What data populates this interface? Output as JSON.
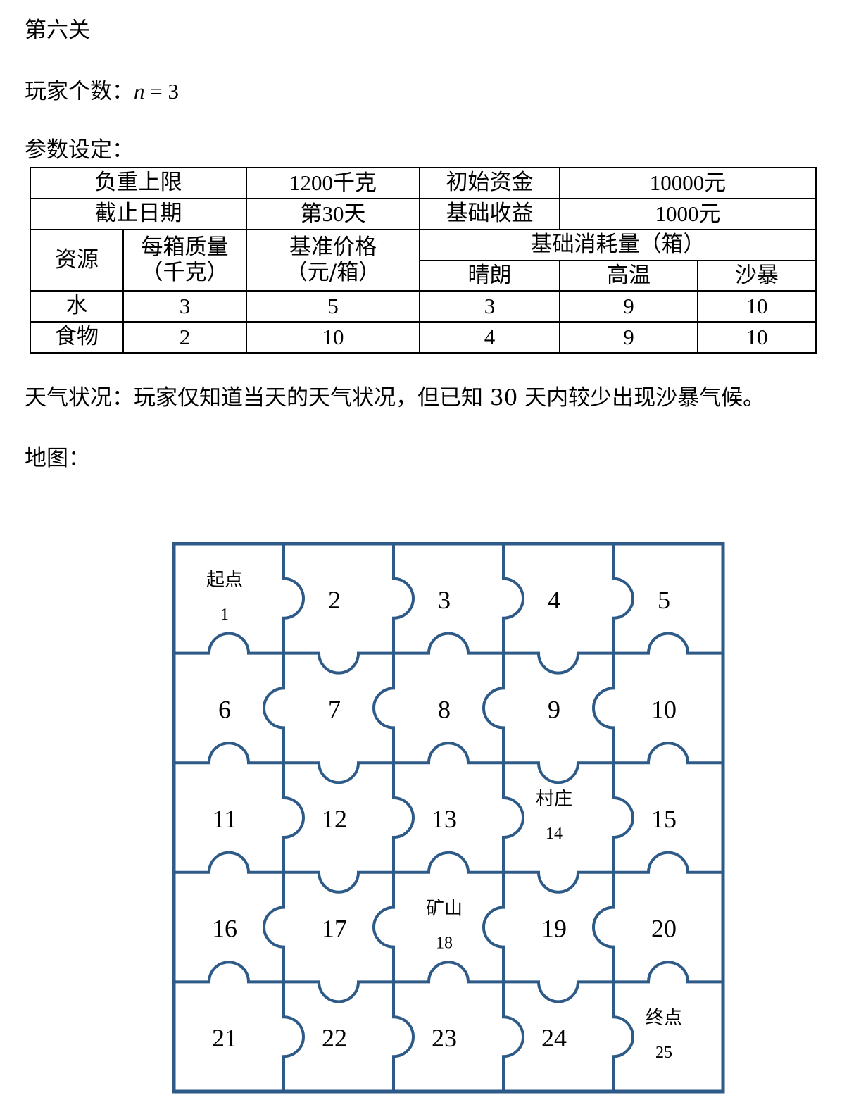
{
  "heading": "第六关",
  "players": {
    "label": "玩家个数：",
    "var": "n",
    "eq": " = ",
    "value": "3"
  },
  "params_label": "参数设定：",
  "table": {
    "load_limit_label": "负重上限",
    "load_limit_value": "1200千克",
    "initial_funds_label": "初始资金",
    "initial_funds_value": "10000元",
    "deadline_label": "截止日期",
    "deadline_value": "第30天",
    "base_income_label": "基础收益",
    "base_income_value": "1000元",
    "resource_header": "资源",
    "mass_header_1": "每箱质量",
    "mass_header_2": "（千克）",
    "price_header_1": "基准价格",
    "price_header_2": "（元/箱）",
    "consumption_header": "基础消耗量（箱）",
    "weather_sunny": "晴朗",
    "weather_hot": "高温",
    "weather_sandstorm": "沙暴",
    "rows": [
      {
        "name": "水",
        "mass": "3",
        "price": "5",
        "sunny": "3",
        "hot": "9",
        "sandstorm": "10"
      },
      {
        "name": "食物",
        "mass": "2",
        "price": "10",
        "sunny": "4",
        "hot": "9",
        "sandstorm": "10"
      }
    ]
  },
  "weather_text": "天气状况：玩家仅知道当天的天气状况，但已知 30 天内较少出现沙暴气候。",
  "map_label": "地图：",
  "map": {
    "line_color": "#2e5a88",
    "cells": [
      {
        "id": "1",
        "tag": "起点"
      },
      {
        "id": "2"
      },
      {
        "id": "3"
      },
      {
        "id": "4"
      },
      {
        "id": "5"
      },
      {
        "id": "6"
      },
      {
        "id": "7"
      },
      {
        "id": "8"
      },
      {
        "id": "9"
      },
      {
        "id": "10"
      },
      {
        "id": "11"
      },
      {
        "id": "12"
      },
      {
        "id": "13"
      },
      {
        "id": "14",
        "tag": "村庄"
      },
      {
        "id": "15"
      },
      {
        "id": "16"
      },
      {
        "id": "17"
      },
      {
        "id": "18",
        "tag": "矿山"
      },
      {
        "id": "19"
      },
      {
        "id": "20"
      },
      {
        "id": "21"
      },
      {
        "id": "22"
      },
      {
        "id": "23"
      },
      {
        "id": "24"
      },
      {
        "id": "25",
        "tag": "终点"
      }
    ]
  }
}
